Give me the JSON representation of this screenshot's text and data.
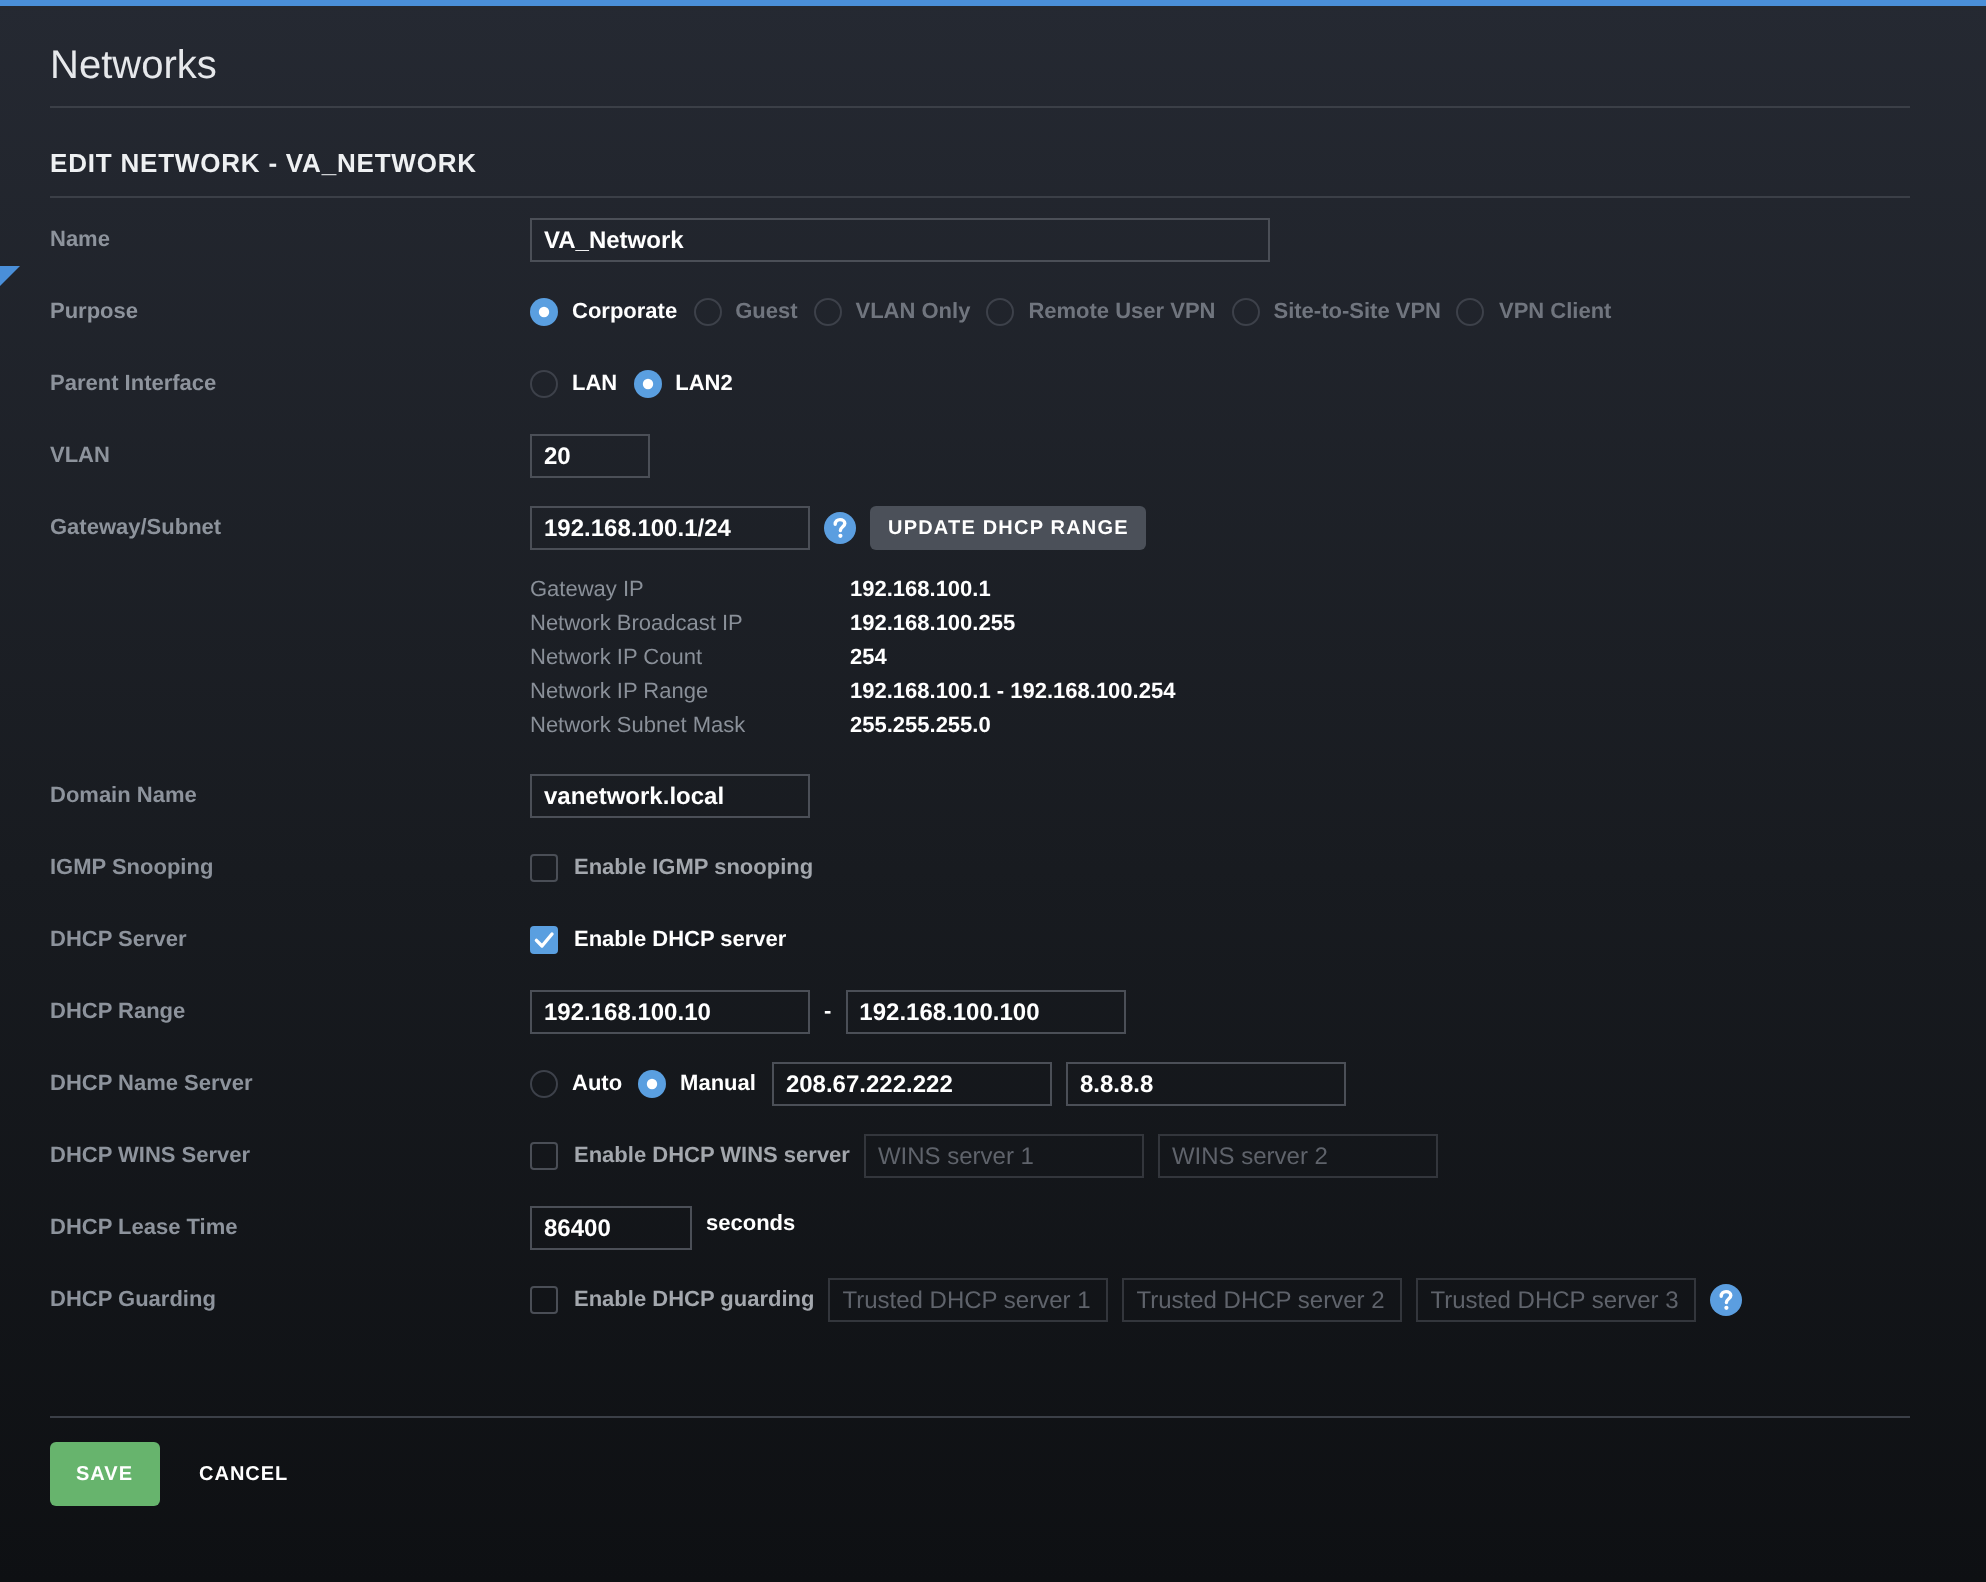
{
  "page_title": "Networks",
  "form": {
    "title": "EDIT NETWORK - VA_NETWORK",
    "rows": [
      {
        "label": "Name",
        "fields": [
          {
            "value": "VA_Network",
            "disabled": false
          }
        ]
      },
      {
        "label": "Purpose",
        "options": [
          {
            "label": "Corporate",
            "selected": true,
            "disabled": false
          },
          {
            "label": "Guest",
            "selected": false,
            "disabled": true
          },
          {
            "label": "VLAN Only",
            "selected": false,
            "disabled": true
          },
          {
            "label": "Remote User VPN",
            "selected": false,
            "disabled": true
          },
          {
            "label": "Site-to-Site VPN",
            "selected": false,
            "disabled": true
          },
          {
            "label": "VPN Client",
            "selected": false,
            "disabled": true
          }
        ]
      },
      {
        "label": "Parent Interface",
        "options": [
          {
            "label": "LAN",
            "selected": false,
            "disabled": false
          },
          {
            "label": "LAN2",
            "selected": true,
            "disabled": false
          }
        ]
      },
      {
        "label": "VLAN",
        "fields": [
          {
            "value": "20",
            "disabled": false
          }
        ]
      },
      {
        "label": "Gateway/Subnet",
        "fields": [
          {
            "value": "192.168.100.1/24",
            "disabled": false
          }
        ],
        "help": true,
        "button": "UPDATE DHCP RANGE",
        "details": [
          {
            "label": "Gateway IP",
            "value": "192.168.100.1"
          },
          {
            "label": "Network Broadcast IP",
            "value": "192.168.100.255"
          },
          {
            "label": "Network IP Count",
            "value": "254"
          },
          {
            "label": "Network IP Range",
            "value": "192.168.100.1 - 192.168.100.254"
          },
          {
            "label": "Network Subnet Mask",
            "value": "255.255.255.0"
          }
        ]
      },
      {
        "label": "Domain Name",
        "fields": [
          {
            "value": "vanetwork.local",
            "disabled": false
          }
        ]
      },
      {
        "label": "IGMP Snooping",
        "checkbox": {
          "label": "Enable IGMP snooping",
          "checked": false
        }
      },
      {
        "label": "DHCP Server",
        "checkbox": {
          "label": "Enable DHCP server",
          "checked": true
        }
      },
      {
        "label": "DHCP Range",
        "fields": [
          {
            "value": "192.168.100.10",
            "disabled": false
          },
          {
            "value": "192.168.100.100",
            "disabled": false
          }
        ],
        "separator": "-"
      },
      {
        "label": "DHCP Name Server",
        "options": [
          {
            "label": "Auto",
            "selected": false,
            "disabled": false
          },
          {
            "label": "Manual",
            "selected": true,
            "disabled": false
          }
        ],
        "fields": [
          {
            "value": "208.67.222.222",
            "disabled": false
          },
          {
            "value": "8.8.8.8",
            "disabled": false
          }
        ]
      },
      {
        "label": "DHCP WINS Server",
        "checkbox": {
          "label": "Enable DHCP WINS server",
          "checked": false
        },
        "fields": [
          {
            "placeholder": "WINS server 1",
            "disabled": true
          },
          {
            "placeholder": "WINS server 2",
            "disabled": true
          }
        ]
      },
      {
        "label": "DHCP Lease Time",
        "fields": [
          {
            "value": "86400",
            "disabled": false
          }
        ],
        "suffix": "seconds"
      },
      {
        "label": "DHCP Guarding",
        "checkbox": {
          "label": "Enable DHCP guarding",
          "checked": false
        },
        "fields": [
          {
            "placeholder": "Trusted DHCP server 1",
            "disabled": true
          },
          {
            "placeholder": "Trusted DHCP server 2",
            "disabled": true
          },
          {
            "placeholder": "Trusted DHCP server 3",
            "disabled": true
          }
        ],
        "help": true
      }
    ]
  },
  "footer": {
    "buttons": [
      {
        "label": "SAVE",
        "kind": "primary"
      },
      {
        "label": "CANCEL",
        "kind": "link"
      }
    ]
  }
}
